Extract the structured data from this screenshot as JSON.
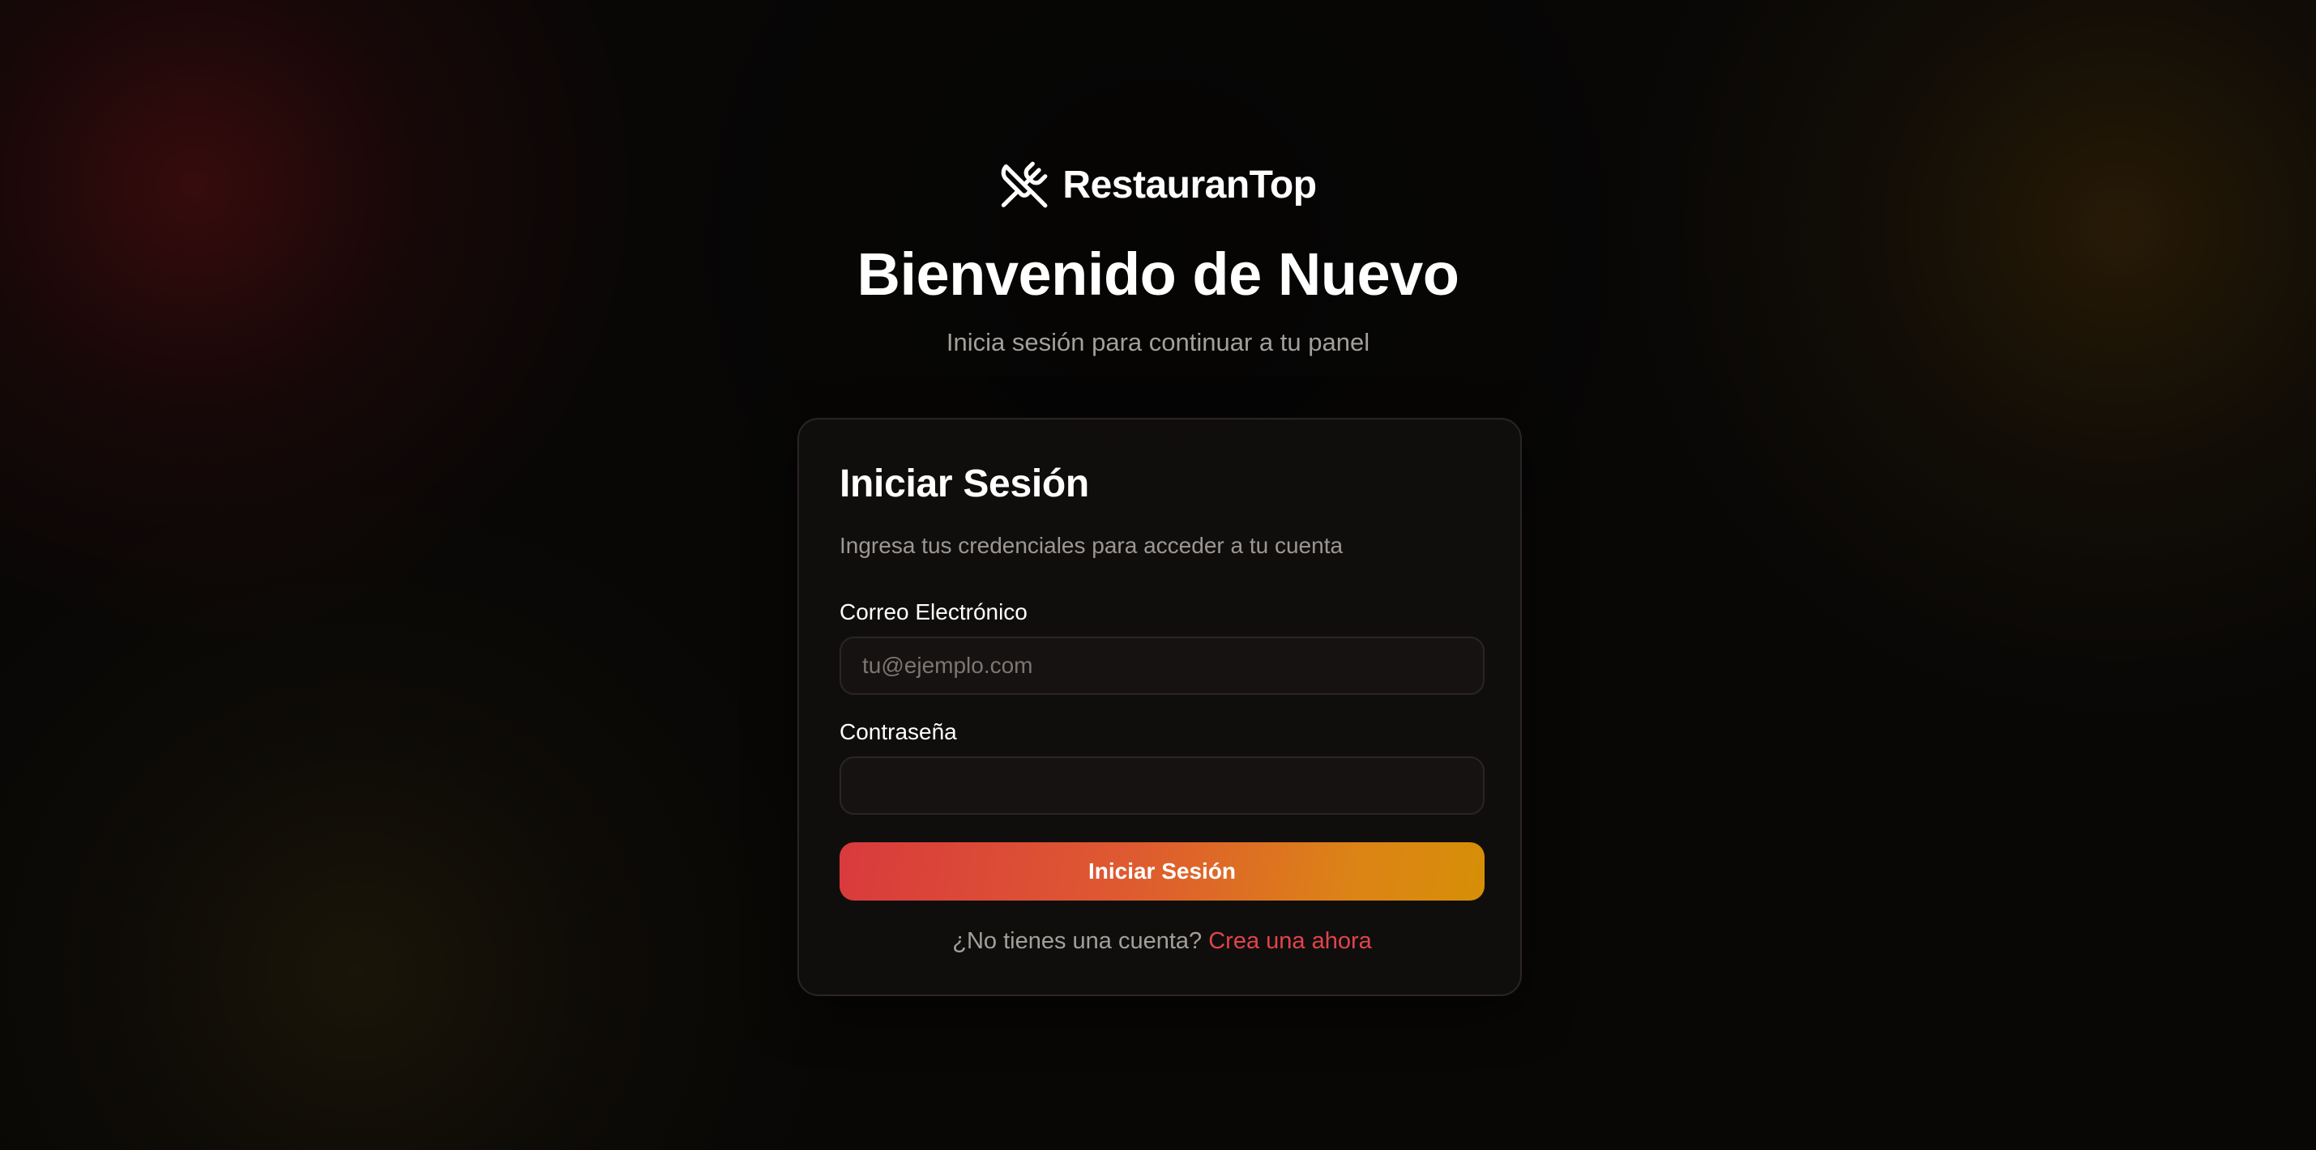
{
  "brand": {
    "name": "RestauranTop",
    "icon": "utensils-crossed-icon"
  },
  "hero": {
    "title": "Bienvenido de Nuevo",
    "subtitle": "Inicia sesión para continuar a tu panel"
  },
  "login_card": {
    "title": "Iniciar Sesión",
    "description": "Ingresa tus credenciales para acceder a tu cuenta",
    "email": {
      "label": "Correo Electrónico",
      "placeholder": "tu@ejemplo.com",
      "value": ""
    },
    "password": {
      "label": "Contraseña",
      "placeholder": "",
      "value": ""
    },
    "submit_label": "Iniciar Sesión",
    "signup_prompt": "¿No tienes una cuenta?",
    "signup_link": "Crea una ahora"
  },
  "colors": {
    "background": "#080706",
    "accent_red": "#e0454a",
    "gradient_start": "#d93a3d",
    "gradient_end": "#d68f06",
    "muted_text": "#a39f9b"
  }
}
